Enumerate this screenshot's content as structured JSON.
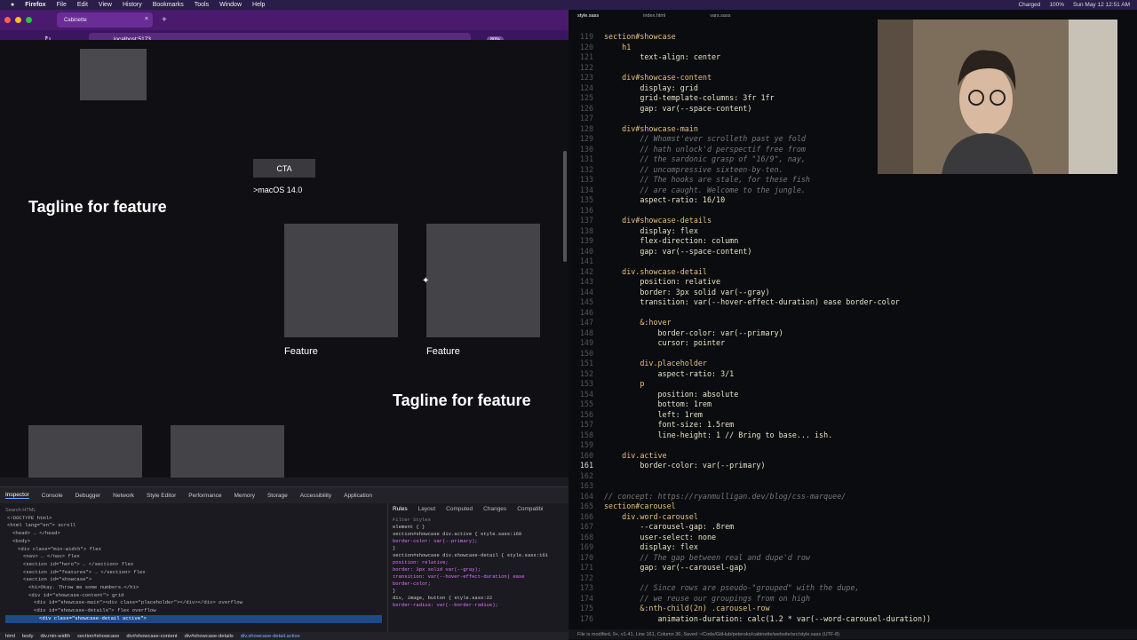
{
  "menubar": {
    "app": "Firefox",
    "items": [
      "File",
      "Edit",
      "View",
      "History",
      "Bookmarks",
      "Tools",
      "Window",
      "Help"
    ],
    "battery": "Charged",
    "battery_pct": "100%",
    "datetime": "Sun May 12 12:51 AM"
  },
  "browser": {
    "tab_title": "Cabinette",
    "url": "localhost:5173",
    "zoom": "80%"
  },
  "page": {
    "cta": "CTA",
    "macos": ">macOS 14.0",
    "tagline1": "Tagline for feature",
    "tagline2": "Tagline for feature",
    "feature1": "Feature",
    "feature2": "Feature"
  },
  "devtools": {
    "tabs": [
      "Inspector",
      "Console",
      "Debugger",
      "Network",
      "Style Editor",
      "Performance",
      "Memory",
      "Storage",
      "Accessibility",
      "Application"
    ],
    "search_placeholder": "Search HTML",
    "tree": [
      "<!DOCTYPE html>",
      "<html lang=\"en\"> scroll",
      "<head> … </head>",
      "<body>",
      "<div class=\"min-width\"> flex",
      "<nav> … </nav> flex",
      "<section id=\"hero\"> … </section> flex",
      "<section id=\"features\"> … </section> flex",
      "<section id=\"showcase\">",
      "<h1>Okay. Throw me some numbers.</h1>",
      "<div id=\"showcase-content\"> grid",
      "<div id=\"showcase-main\"><div class=\"placeholder\"></div></div> overflow",
      "<div id=\"showcase-details\"> flex overflow",
      "<div class=\"showcase-detail active\">"
    ],
    "rule_tabs": [
      "Rules",
      "Layout",
      "Computed",
      "Changes",
      "Compatibi"
    ],
    "rules": [
      "element { }",
      "section#showcase div.active { style.sass:160",
      "  border-color: var(--primary);",
      "}",
      "section#showcase div.showcase-detail { style.sass:161",
      "  position: relative;",
      "  border: 3px solid var(--gray);",
      "  transition: var(--hover-effect-duration) ease",
      "  border-color;",
      "}",
      "div, image, button { style.sass:22",
      "  border-radius: var(--border-radius);"
    ],
    "filter_placeholder": "Filter Styles",
    "crumbs": [
      "html",
      "body",
      "div.min-width",
      "section#showcase",
      "div#showcase-content",
      "div#showcase-details",
      "div.showcase-detail.active"
    ]
  },
  "editor": {
    "tabs": [
      "style.sass",
      "index.html",
      "vars.sass"
    ],
    "status": "File is modified, 9+, v1.41, Line 161, Column 36, Saved ~/Code/GitHub/petersko/cabinette/website/src/style.sass (UTF-8)",
    "lines": [
      {
        "n": "119",
        "t": "section#showcase"
      },
      {
        "n": "120",
        "t": "    h1"
      },
      {
        "n": "121",
        "t": "        text-align: center"
      },
      {
        "n": "122",
        "t": ""
      },
      {
        "n": "123",
        "t": "    div#showcase-content"
      },
      {
        "n": "124",
        "t": "        display: grid"
      },
      {
        "n": "125",
        "t": "        grid-template-columns: 3fr 1fr"
      },
      {
        "n": "126",
        "t": "        gap: var(--space-content)"
      },
      {
        "n": "127",
        "t": ""
      },
      {
        "n": "128",
        "t": "    div#showcase-main"
      },
      {
        "n": "129",
        "t": "        // Whomst'ever scrolleth past ye fold"
      },
      {
        "n": "130",
        "t": "        // hath unlock'd perspectif free from"
      },
      {
        "n": "131",
        "t": "        // the sardonic grasp of \"16/9\", nay,"
      },
      {
        "n": "132",
        "t": "        // uncompressive sixteen-by-ten."
      },
      {
        "n": "133",
        "t": "        // The hooks are stale, for these fish"
      },
      {
        "n": "134",
        "t": "        // are caught. Welcome to the jungle."
      },
      {
        "n": "135",
        "t": "        aspect-ratio: 16/10"
      },
      {
        "n": "136",
        "t": ""
      },
      {
        "n": "137",
        "t": "    div#showcase-details"
      },
      {
        "n": "138",
        "t": "        display: flex"
      },
      {
        "n": "139",
        "t": "        flex-direction: column"
      },
      {
        "n": "140",
        "t": "        gap: var(--space-content)"
      },
      {
        "n": "141",
        "t": ""
      },
      {
        "n": "142",
        "t": "    div.showcase-detail"
      },
      {
        "n": "143",
        "t": "        position: relative"
      },
      {
        "n": "144",
        "t": "        border: 3px solid var(--gray)"
      },
      {
        "n": "145",
        "t": "        transition: var(--hover-effect-duration) ease border-color"
      },
      {
        "n": "146",
        "t": ""
      },
      {
        "n": "147",
        "t": "        &:hover"
      },
      {
        "n": "148",
        "t": "            border-color: var(--primary)"
      },
      {
        "n": "149",
        "t": "            cursor: pointer"
      },
      {
        "n": "150",
        "t": ""
      },
      {
        "n": "151",
        "t": "        div.placeholder"
      },
      {
        "n": "152",
        "t": "            aspect-ratio: 3/1"
      },
      {
        "n": "153",
        "t": "        p"
      },
      {
        "n": "154",
        "t": "            position: absolute"
      },
      {
        "n": "155",
        "t": "            bottom: 1rem"
      },
      {
        "n": "156",
        "t": "            left: 1rem"
      },
      {
        "n": "157",
        "t": "            font-size: 1.5rem"
      },
      {
        "n": "158",
        "t": "            line-height: 1 // Bring to base... ish."
      },
      {
        "n": "159",
        "t": ""
      },
      {
        "n": "160",
        "t": "    div.active"
      },
      {
        "n": "161",
        "t": "        border-color: var(--primary)"
      },
      {
        "n": "162",
        "t": ""
      },
      {
        "n": "163",
        "t": ""
      },
      {
        "n": "164",
        "t": "// concept: https://ryanmulligan.dev/blog/css-marquee/"
      },
      {
        "n": "165",
        "t": "section#carousel"
      },
      {
        "n": "166",
        "t": "    div.word-carousel"
      },
      {
        "n": "167",
        "t": "        --carousel-gap: .8rem"
      },
      {
        "n": "168",
        "t": "        user-select: none"
      },
      {
        "n": "169",
        "t": "        display: flex"
      },
      {
        "n": "170",
        "t": "        // The gap between real and dupe'd row"
      },
      {
        "n": "171",
        "t": "        gap: var(--carousel-gap)"
      },
      {
        "n": "172",
        "t": ""
      },
      {
        "n": "173",
        "t": "        // Since rows are pseudo-\"grouped\" with the dupe,"
      },
      {
        "n": "174",
        "t": "        // we reuse our groupings from on high"
      },
      {
        "n": "175",
        "t": "        &:nth-child(2n) .carousel-row"
      },
      {
        "n": "176",
        "t": "            animation-duration: calc(1.2 * var(--word-carousel-duration))"
      }
    ]
  }
}
